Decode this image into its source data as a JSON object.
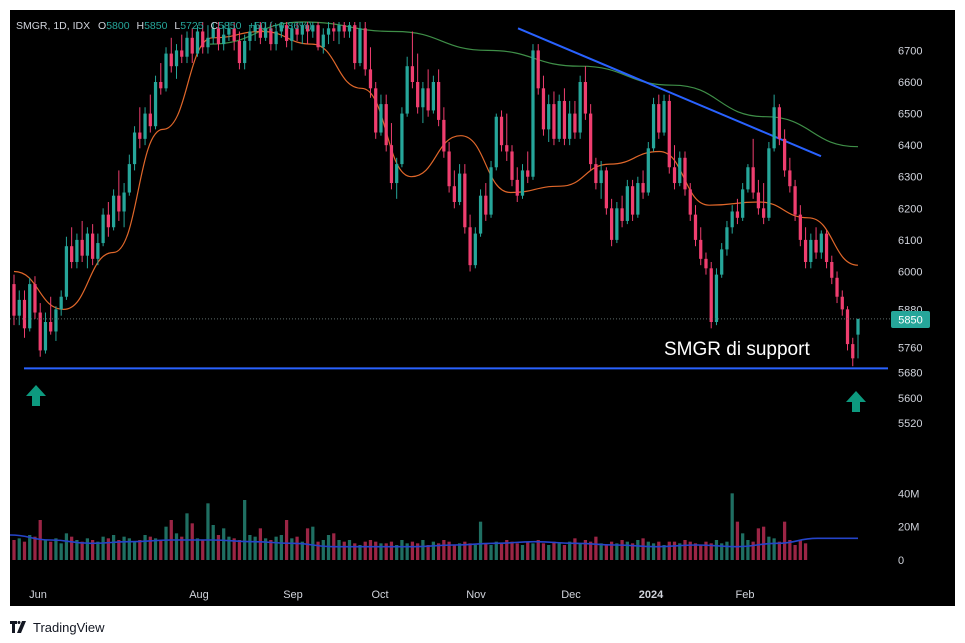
{
  "header": {
    "symbol": "SMGR, 1D, IDX",
    "open_label": "O",
    "open": "5800",
    "high_label": "H",
    "high": "5850",
    "low_label": "L",
    "low": "5725",
    "close_label": "C",
    "close": "5850",
    "change": "+50 (+0.86%)"
  },
  "footer": {
    "brand": "TradingView"
  },
  "annotation": {
    "text": "SMGR di support"
  },
  "price_tag": "5850",
  "colors": {
    "background": "#000000",
    "up": "#26a69a",
    "down": "#ef3e6f",
    "ma_short": "#e0672a",
    "ma_long": "#3f8f48",
    "trendline": "#2962ff",
    "volume_ma": "#2544c9",
    "arrow": "#0d9a7f"
  },
  "icons": [
    "up-arrow-icon",
    "tradingview-logo-icon"
  ],
  "chart_data": {
    "type": "candlestick",
    "title": "SMGR, 1D, IDX",
    "price_axis": {
      "ticks": [
        6700,
        6600,
        6500,
        6400,
        6300,
        6200,
        6100,
        6000,
        5880,
        5760,
        5680,
        5600,
        5520
      ],
      "range": [
        5460,
        6790
      ]
    },
    "volume_axis": {
      "ticks": [
        "40M",
        "20M",
        "0"
      ],
      "max": 45000000
    },
    "time_axis": {
      "labels": [
        "Jun",
        "Aug",
        "Sep",
        "Oct",
        "Nov",
        "Dec",
        "2024",
        "Feb"
      ]
    },
    "last_price": 5850,
    "current_price_line": 5850,
    "support_level": 5693,
    "resistance_trendline": {
      "start": [
        "Nov-16",
        6770
      ],
      "end": [
        "Mar-01",
        6365
      ]
    },
    "moving_averages": [
      {
        "role": "short",
        "anchors": [
          6000,
          5880,
          6060,
          6450,
          6740,
          6760,
          6720,
          6580,
          6300,
          6430,
          6250,
          6270,
          6340,
          6380,
          6210,
          6220,
          6170,
          6020
        ]
      },
      {
        "role": "long",
        "anchors": [
          6720,
          6790,
          6760,
          6700,
          6650,
          6590,
          6490,
          6395
        ]
      }
    ],
    "ohlc": [
      [
        5960,
        5990,
        5830,
        5860
      ],
      [
        5860,
        5940,
        5830,
        5910
      ],
      [
        5910,
        5940,
        5790,
        5820
      ],
      [
        5820,
        5980,
        5810,
        5960
      ],
      [
        5960,
        5985,
        5850,
        5870
      ],
      [
        5870,
        5900,
        5730,
        5750
      ],
      [
        5750,
        5870,
        5740,
        5840
      ],
      [
        5840,
        5920,
        5800,
        5810
      ],
      [
        5810,
        5890,
        5780,
        5880
      ],
      [
        5880,
        5940,
        5860,
        5920
      ],
      [
        5920,
        6110,
        5910,
        6080
      ],
      [
        6080,
        6140,
        6010,
        6030
      ],
      [
        6030,
        6120,
        6010,
        6100
      ],
      [
        6100,
        6160,
        6030,
        6050
      ],
      [
        6050,
        6140,
        6010,
        6120
      ],
      [
        6120,
        6150,
        6020,
        6040
      ],
      [
        6040,
        6120,
        6020,
        6090
      ],
      [
        6090,
        6200,
        6080,
        6180
      ],
      [
        6180,
        6220,
        6110,
        6140
      ],
      [
        6140,
        6260,
        6130,
        6240
      ],
      [
        6240,
        6320,
        6160,
        6190
      ],
      [
        6190,
        6280,
        6140,
        6250
      ],
      [
        6250,
        6370,
        6240,
        6340
      ],
      [
        6340,
        6460,
        6320,
        6440
      ],
      [
        6440,
        6520,
        6390,
        6420
      ],
      [
        6420,
        6520,
        6400,
        6500
      ],
      [
        6500,
        6560,
        6440,
        6460
      ],
      [
        6460,
        6620,
        6450,
        6600
      ],
      [
        6600,
        6660,
        6560,
        6580
      ],
      [
        6580,
        6710,
        6570,
        6690
      ],
      [
        6690,
        6740,
        6630,
        6650
      ],
      [
        6650,
        6720,
        6610,
        6700
      ],
      [
        6700,
        6750,
        6660,
        6680
      ],
      [
        6680,
        6760,
        6660,
        6740
      ],
      [
        6740,
        6770,
        6660,
        6690
      ],
      [
        6690,
        6780,
        6680,
        6760
      ],
      [
        6760,
        6790,
        6690,
        6710
      ],
      [
        6710,
        6780,
        6690,
        6740
      ],
      [
        6740,
        6790,
        6720,
        6770
      ],
      [
        6770,
        6790,
        6700,
        6720
      ],
      [
        6720,
        6780,
        6700,
        6750
      ],
      [
        6750,
        6790,
        6730,
        6770
      ],
      [
        6770,
        6790,
        6700,
        6730
      ],
      [
        6730,
        6760,
        6640,
        6660
      ],
      [
        6660,
        6750,
        6640,
        6730
      ],
      [
        6730,
        6780,
        6700,
        6760
      ],
      [
        6760,
        6790,
        6730,
        6780
      ],
      [
        6780,
        6790,
        6720,
        6740
      ],
      [
        6740,
        6790,
        6730,
        6770
      ],
      [
        6770,
        6790,
        6700,
        6720
      ],
      [
        6720,
        6780,
        6700,
        6760
      ],
      [
        6760,
        6790,
        6740,
        6780
      ],
      [
        6780,
        6790,
        6710,
        6730
      ],
      [
        6730,
        6780,
        6700,
        6770
      ],
      [
        6770,
        6790,
        6730,
        6750
      ],
      [
        6750,
        6790,
        6720,
        6780
      ],
      [
        6780,
        6790,
        6720,
        6760
      ],
      [
        6760,
        6790,
        6740,
        6780
      ],
      [
        6780,
        6790,
        6700,
        6710
      ],
      [
        6710,
        6770,
        6690,
        6750
      ],
      [
        6750,
        6790,
        6720,
        6770
      ],
      [
        6770,
        6790,
        6730,
        6760
      ],
      [
        6760,
        6790,
        6720,
        6780
      ],
      [
        6780,
        6790,
        6740,
        6760
      ],
      [
        6760,
        6790,
        6740,
        6780
      ],
      [
        6780,
        6790,
        6640,
        6660
      ],
      [
        6660,
        6790,
        6650,
        6770
      ],
      [
        6770,
        6790,
        6620,
        6640
      ],
      [
        6640,
        6710,
        6550,
        6580
      ],
      [
        6580,
        6600,
        6420,
        6440
      ],
      [
        6440,
        6560,
        6430,
        6530
      ],
      [
        6530,
        6560,
        6380,
        6400
      ],
      [
        6400,
        6470,
        6260,
        6280
      ],
      [
        6280,
        6360,
        6230,
        6340
      ],
      [
        6340,
        6520,
        6330,
        6500
      ],
      [
        6500,
        6680,
        6490,
        6650
      ],
      [
        6650,
        6760,
        6580,
        6600
      ],
      [
        6600,
        6690,
        6500,
        6520
      ],
      [
        6520,
        6600,
        6470,
        6580
      ],
      [
        6580,
        6640,
        6490,
        6510
      ],
      [
        6510,
        6620,
        6500,
        6600
      ],
      [
        6600,
        6640,
        6460,
        6480
      ],
      [
        6480,
        6520,
        6360,
        6380
      ],
      [
        6380,
        6410,
        6250,
        6270
      ],
      [
        6270,
        6320,
        6200,
        6220
      ],
      [
        6220,
        6340,
        6210,
        6310
      ],
      [
        6310,
        6340,
        6120,
        6140
      ],
      [
        6140,
        6180,
        6000,
        6020
      ],
      [
        6020,
        6140,
        6010,
        6120
      ],
      [
        6120,
        6260,
        6110,
        6240
      ],
      [
        6240,
        6280,
        6160,
        6180
      ],
      [
        6180,
        6350,
        6170,
        6330
      ],
      [
        6330,
        6500,
        6320,
        6490
      ],
      [
        6490,
        6510,
        6380,
        6400
      ],
      [
        6400,
        6500,
        6350,
        6380
      ],
      [
        6380,
        6400,
        6270,
        6290
      ],
      [
        6290,
        6330,
        6220,
        6240
      ],
      [
        6240,
        6340,
        6230,
        6320
      ],
      [
        6320,
        6380,
        6280,
        6300
      ],
      [
        6300,
        6720,
        6290,
        6700
      ],
      [
        6700,
        6720,
        6560,
        6580
      ],
      [
        6580,
        6620,
        6430,
        6450
      ],
      [
        6450,
        6560,
        6410,
        6530
      ],
      [
        6530,
        6570,
        6400,
        6420
      ],
      [
        6420,
        6560,
        6410,
        6540
      ],
      [
        6540,
        6580,
        6400,
        6420
      ],
      [
        6420,
        6540,
        6400,
        6500
      ],
      [
        6500,
        6540,
        6420,
        6440
      ],
      [
        6440,
        6620,
        6420,
        6600
      ],
      [
        6600,
        6650,
        6480,
        6500
      ],
      [
        6500,
        6530,
        6320,
        6340
      ],
      [
        6340,
        6360,
        6260,
        6280
      ],
      [
        6280,
        6350,
        6230,
        6320
      ],
      [
        6320,
        6330,
        6180,
        6200
      ],
      [
        6200,
        6230,
        6080,
        6100
      ],
      [
        6100,
        6220,
        6090,
        6200
      ],
      [
        6200,
        6240,
        6140,
        6160
      ],
      [
        6160,
        6290,
        6150,
        6270
      ],
      [
        6270,
        6290,
        6160,
        6180
      ],
      [
        6180,
        6300,
        6170,
        6280
      ],
      [
        6280,
        6320,
        6230,
        6250
      ],
      [
        6250,
        6410,
        6240,
        6390
      ],
      [
        6390,
        6550,
        6380,
        6530
      ],
      [
        6530,
        6560,
        6420,
        6440
      ],
      [
        6440,
        6560,
        6430,
        6540
      ],
      [
        6540,
        6560,
        6310,
        6330
      ],
      [
        6330,
        6400,
        6260,
        6280
      ],
      [
        6280,
        6380,
        6270,
        6360
      ],
      [
        6360,
        6380,
        6240,
        6260
      ],
      [
        6260,
        6280,
        6160,
        6180
      ],
      [
        6180,
        6210,
        6080,
        6100
      ],
      [
        6100,
        6140,
        6020,
        6040
      ],
      [
        6040,
        6060,
        5990,
        6010
      ],
      [
        6010,
        6030,
        5820,
        5840
      ],
      [
        5840,
        6010,
        5830,
        5990
      ],
      [
        5990,
        6090,
        5980,
        6070
      ],
      [
        6070,
        6160,
        6050,
        6140
      ],
      [
        6140,
        6210,
        6120,
        6190
      ],
      [
        6190,
        6230,
        6150,
        6170
      ],
      [
        6170,
        6280,
        6160,
        6260
      ],
      [
        6260,
        6340,
        6250,
        6330
      ],
      [
        6330,
        6420,
        6230,
        6250
      ],
      [
        6250,
        6290,
        6180,
        6200
      ],
      [
        6200,
        6280,
        6150,
        6170
      ],
      [
        6170,
        6410,
        6160,
        6390
      ],
      [
        6390,
        6560,
        6380,
        6520
      ],
      [
        6520,
        6530,
        6400,
        6420
      ],
      [
        6420,
        6450,
        6300,
        6320
      ],
      [
        6320,
        6360,
        6250,
        6270
      ],
      [
        6270,
        6290,
        6160,
        6180
      ],
      [
        6180,
        6210,
        6080,
        6100
      ],
      [
        6100,
        6140,
        6010,
        6030
      ],
      [
        6030,
        6120,
        6010,
        6100
      ],
      [
        6100,
        6140,
        6040,
        6060
      ],
      [
        6060,
        6130,
        6040,
        6120
      ],
      [
        6120,
        6130,
        6010,
        6030
      ],
      [
        6030,
        6050,
        5960,
        5980
      ],
      [
        5980,
        6000,
        5900,
        5920
      ],
      [
        5920,
        5940,
        5860,
        5880
      ],
      [
        5880,
        5890,
        5750,
        5770
      ],
      [
        5770,
        5790,
        5700,
        5725
      ],
      [
        5800,
        5850,
        5725,
        5850
      ]
    ],
    "volume_millions": [
      12,
      13,
      11,
      15,
      14,
      24,
      12,
      11,
      13,
      10,
      16,
      14,
      12,
      11,
      13,
      12,
      11,
      14,
      13,
      15,
      12,
      14,
      13,
      11,
      12,
      15,
      14,
      13,
      12,
      20,
      24,
      16,
      14,
      28,
      22,
      13,
      12,
      34,
      21,
      15,
      19,
      14,
      13,
      12,
      36,
      15,
      14,
      19,
      13,
      12,
      14,
      15,
      24,
      13,
      14,
      11,
      19,
      20,
      11,
      12,
      15,
      16,
      12,
      11,
      12,
      10,
      9,
      11,
      12,
      11,
      10,
      10,
      11,
      9,
      12,
      10,
      11,
      10,
      12,
      9,
      11,
      10,
      12,
      11,
      9,
      10,
      11,
      10,
      9,
      23,
      10,
      9,
      11,
      10,
      12,
      11,
      10,
      9,
      11,
      10,
      12,
      10,
      9,
      11,
      10,
      9,
      11,
      13,
      10,
      12,
      11,
      14,
      10,
      9,
      11,
      10,
      12,
      11,
      10,
      12,
      13,
      11,
      10,
      11,
      9,
      11,
      11,
      10,
      12,
      11,
      10,
      9,
      11,
      10,
      12,
      10,
      11,
      40,
      23,
      16,
      12,
      11,
      19,
      20,
      14,
      13,
      11,
      23,
      12,
      9,
      12,
      10
    ],
    "volume_ma_anchors": [
      15,
      12,
      10,
      11,
      12,
      12,
      11,
      10,
      8,
      8,
      8,
      9,
      10,
      11,
      10,
      9,
      8,
      9,
      8,
      10,
      13,
      13
    ]
  }
}
